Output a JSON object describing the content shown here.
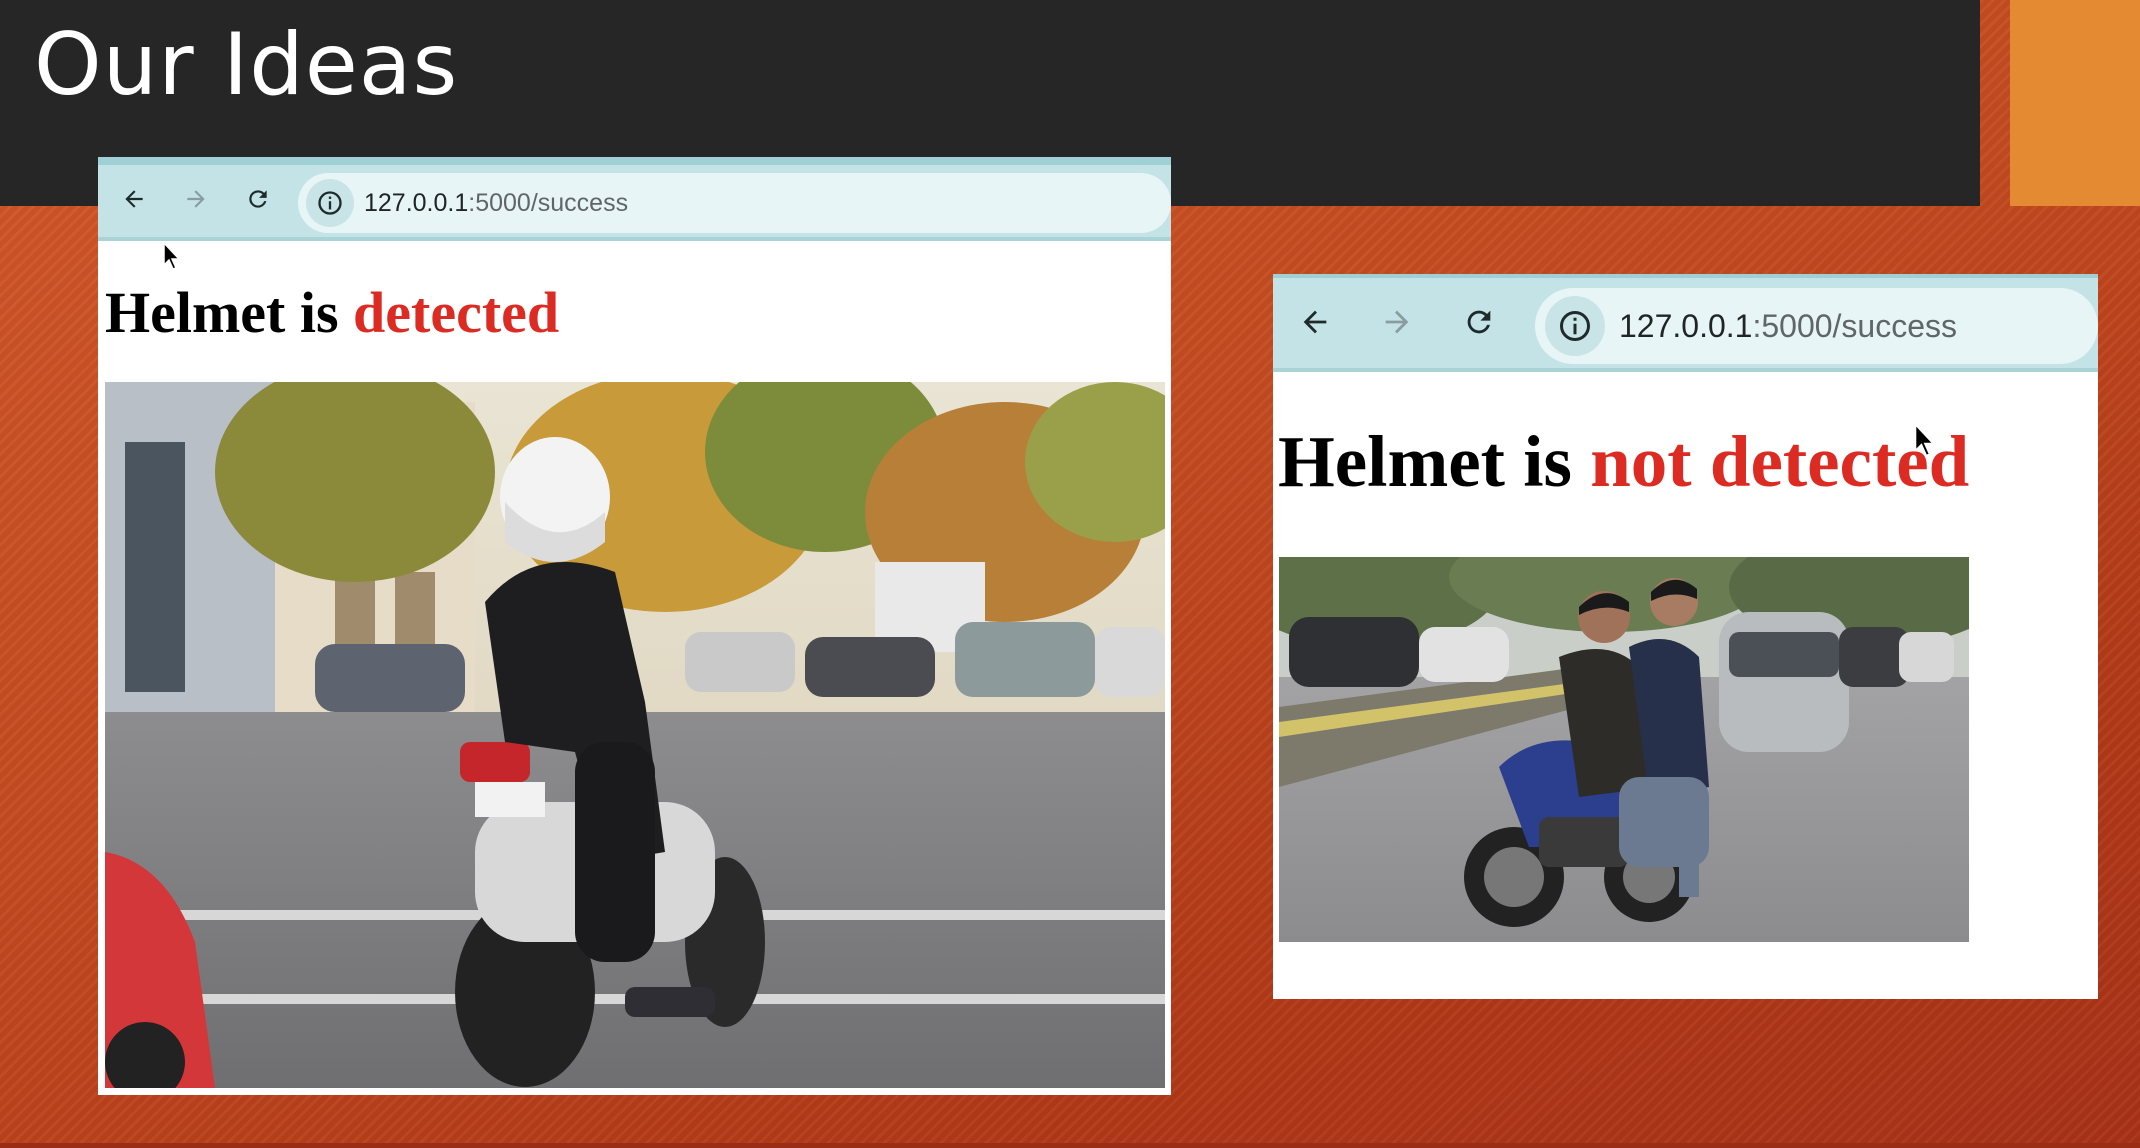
{
  "slide": {
    "title": "Our Ideas",
    "colors": {
      "title_bar": "#262626",
      "accent": "#e38a33",
      "background": "#c44a20"
    }
  },
  "browsers": [
    {
      "url_host": "127.0.0.1",
      "url_path": ":5000/success",
      "nav": [
        "back-icon",
        "forward-icon",
        "reload-icon"
      ],
      "heading_prefix": "Helmet is ",
      "heading_status": "detected",
      "status_color": "#dc2b23",
      "image_subject": "motorcyclist-with-white-helmet-at-intersection"
    },
    {
      "url_host": "127.0.0.1",
      "url_path": ":5000/success",
      "nav": [
        "back-icon",
        "forward-icon",
        "reload-icon"
      ],
      "heading_prefix": "Helmet is ",
      "heading_status": "not detected",
      "status_color": "#dc2b23",
      "image_subject": "two-riders-without-helmets-on-blue-motorcycle"
    }
  ]
}
